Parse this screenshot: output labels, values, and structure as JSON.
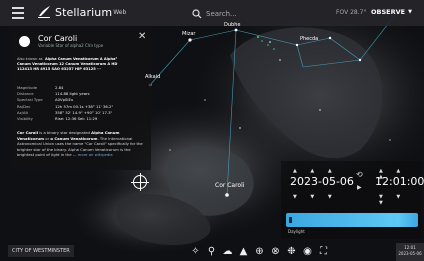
{
  "app": {
    "name": "Stellarium",
    "name_sup": "Web",
    "search_placeholder": "Search...",
    "fov": "FOV 28.7°",
    "observe_label": "OBSERVE"
  },
  "info_panel": {
    "star_name": "Cor Caroli",
    "star_subtitle": "Variable Star of alpha2 CVn type",
    "also_known_as_label": "Also known as",
    "aka_line1": "Alpha Canum Venaticorum A   Alpha²",
    "aka_line2": "Canum Venaticorum     12 Canum Venaticorum A   HD",
    "aka_line3": "112413     HR 4915     SAO 63257     HIP 63125     ···",
    "properties": [
      {
        "key": "Magnitude",
        "value": "2.84"
      },
      {
        "key": "Distance",
        "value": "114.88 light years"
      },
      {
        "key": "Spectral Type",
        "value": "A0VpSiEu"
      },
      {
        "key": "Ra/Dec",
        "value": "12h 57m 00.1s   +38° 11' 36.2\""
      },
      {
        "key": "Az/Alt",
        "value": "358° 52' 14.9\"   +90° 10' 17.3\""
      },
      {
        "key": "Visibility",
        "value": "Rise: 12:36   Set: 11:29"
      }
    ],
    "description_bold1": "Cor Caroli",
    "description_mid1": " is a binary star designated ",
    "description_bold2": "Alpha Canum Venaticorum",
    "description_mid2": " or ",
    "description_bold3": "α Canum Venaticorum",
    "description_rest": ". The International Astronomical Union uses the name \"Cor Caroli\" specifically for the brighter star of the binary. Alpha Canum Venaticorum is the brightest point of light in the ...",
    "wiki_link": "more on wikipedia"
  },
  "sky_labels": {
    "mizar": "Mizar",
    "alkaid": "Alkaid",
    "phecda": "Phecda",
    "dubhe": "Dubhe",
    "cor_caroli": "Cor Caroli"
  },
  "time_panel": {
    "date": "2023-05-06",
    "time": "12:01:00",
    "slider_label": "Daylight"
  },
  "location": "CITY OF WESTMINSTER",
  "clock": {
    "time": "12:01",
    "date": "2023-05-06"
  },
  "icons": [
    "menu-icon",
    "search-icon",
    "target-icon",
    "close-icon",
    "reset-icon",
    "play-icon",
    "constellations-icon",
    "art-icon",
    "atmosphere-icon",
    "landscape-icon",
    "azimuthal-grid-icon",
    "equatorial-grid-icon",
    "nebulae-icon",
    "night-mode-icon",
    "fullscreen-icon"
  ]
}
